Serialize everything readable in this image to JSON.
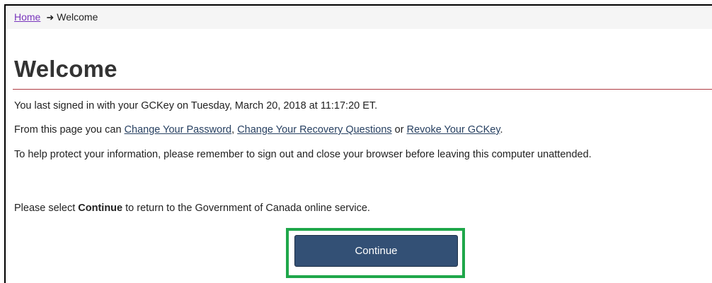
{
  "breadcrumb": {
    "home_label": "Home",
    "separator_icon": "arrow-right-icon",
    "current_label": "Welcome"
  },
  "page": {
    "title": "Welcome"
  },
  "content": {
    "last_signed_in": "You last signed in with your GCKey on Tuesday, March 20, 2018 at 11:17:20 ET.",
    "actions_intro": "From this page you can ",
    "change_password_link": "Change Your Password",
    "comma": ", ",
    "change_recovery_link": "Change Your Recovery Questions",
    "or_text": " or ",
    "revoke_link": "Revoke Your GCKey",
    "period": ".",
    "protect_info": "To help protect your information, please remember to sign out and close your browser before leaving this computer unattended.",
    "select_prefix": "Please select ",
    "select_bold": "Continue",
    "select_suffix": " to return to the Government of Canada online service."
  },
  "buttons": {
    "continue_label": "Continue"
  },
  "colors": {
    "link_visited": "#7834bc",
    "link": "#284162",
    "title_rule": "#af3c43",
    "button_bg": "#335075",
    "highlight": "#1fa74a"
  }
}
